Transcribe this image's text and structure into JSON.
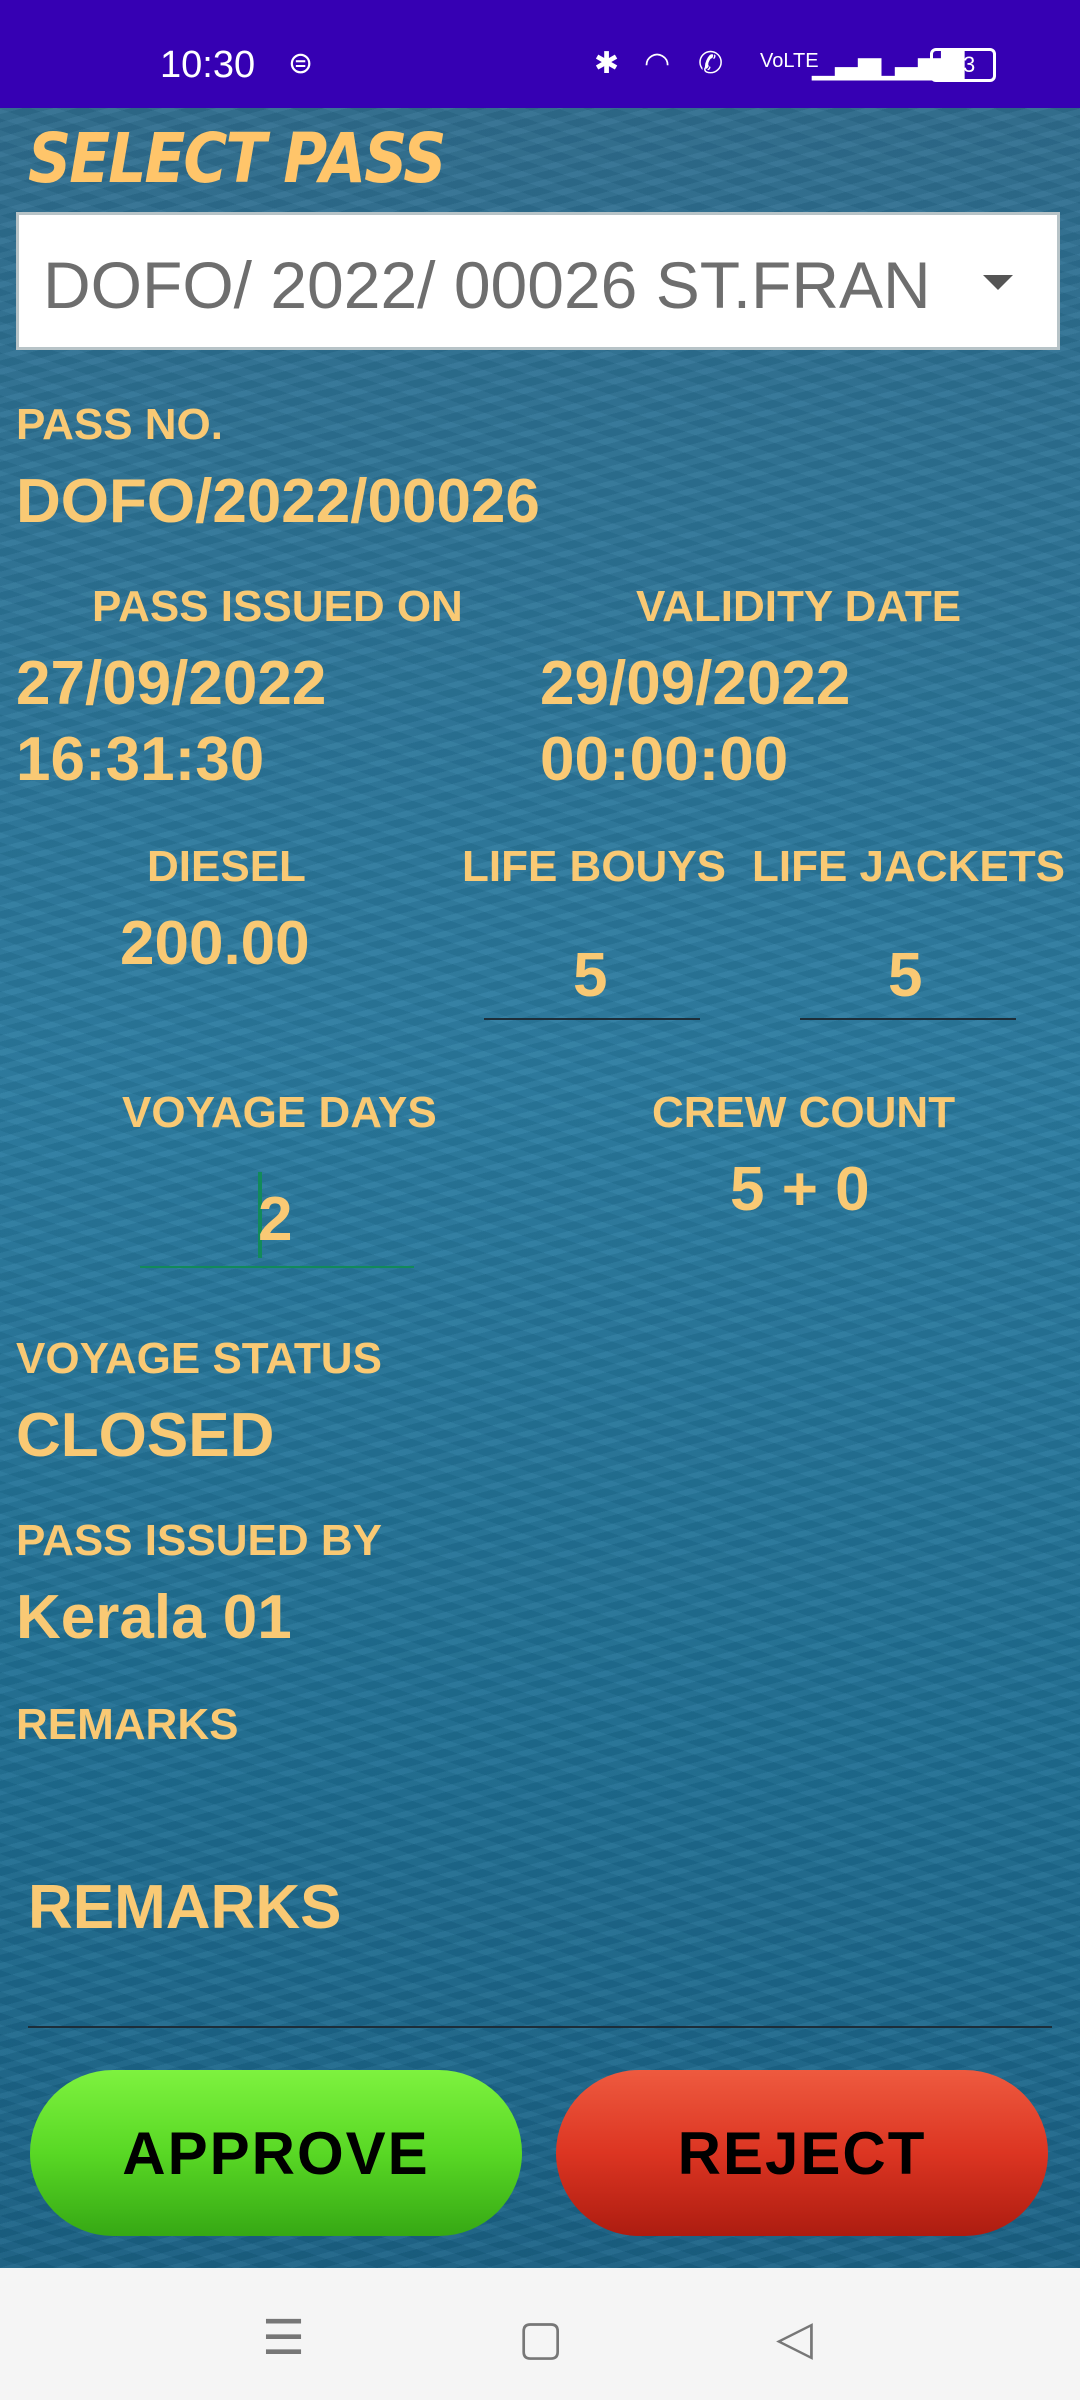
{
  "status_bar": {
    "time": "10:30",
    "battery": "93",
    "icons": [
      "sim-status-icon",
      "bluetooth-icon",
      "wifi-icon",
      "wifi-calling-icon",
      "volte-icon",
      "signal-icon",
      "signal-icon",
      "battery-icon"
    ]
  },
  "header": {
    "title": "SELECT PASS"
  },
  "pass_select": {
    "selected": "DOFO/ 2022/ 00026 ST.FRAN"
  },
  "pass_no": {
    "label": "PASS NO.",
    "value": "DOFO/2022/00026"
  },
  "issued_on": {
    "label": "PASS ISSUED ON",
    "date": "27/09/2022",
    "time": "16:31:30"
  },
  "validity": {
    "label": "VALIDITY DATE",
    "date": "29/09/2022",
    "time": "00:00:00"
  },
  "diesel": {
    "label": "DIESEL",
    "value": "200.00"
  },
  "life_bouys": {
    "label": "LIFE BOUYS",
    "value": "5"
  },
  "life_jackets": {
    "label": "LIFE JACKETS",
    "value": "5"
  },
  "voyage_days": {
    "label": "VOYAGE DAYS",
    "value": "2"
  },
  "crew_count": {
    "label": "CREW COUNT",
    "value": "5 + 0"
  },
  "voyage_status": {
    "label": "VOYAGE STATUS",
    "value": "CLOSED"
  },
  "issued_by": {
    "label": "PASS ISSUED BY",
    "value": "Kerala 01"
  },
  "remarks": {
    "label": "REMARKS",
    "placeholder": "REMARKS"
  },
  "actions": {
    "approve": "APPROVE",
    "reject": "REJECT"
  },
  "colors": {
    "status_bar": "#3600b3",
    "label_gold": "#f9c974",
    "approve_green": "#59d825",
    "reject_red": "#dc3522"
  }
}
